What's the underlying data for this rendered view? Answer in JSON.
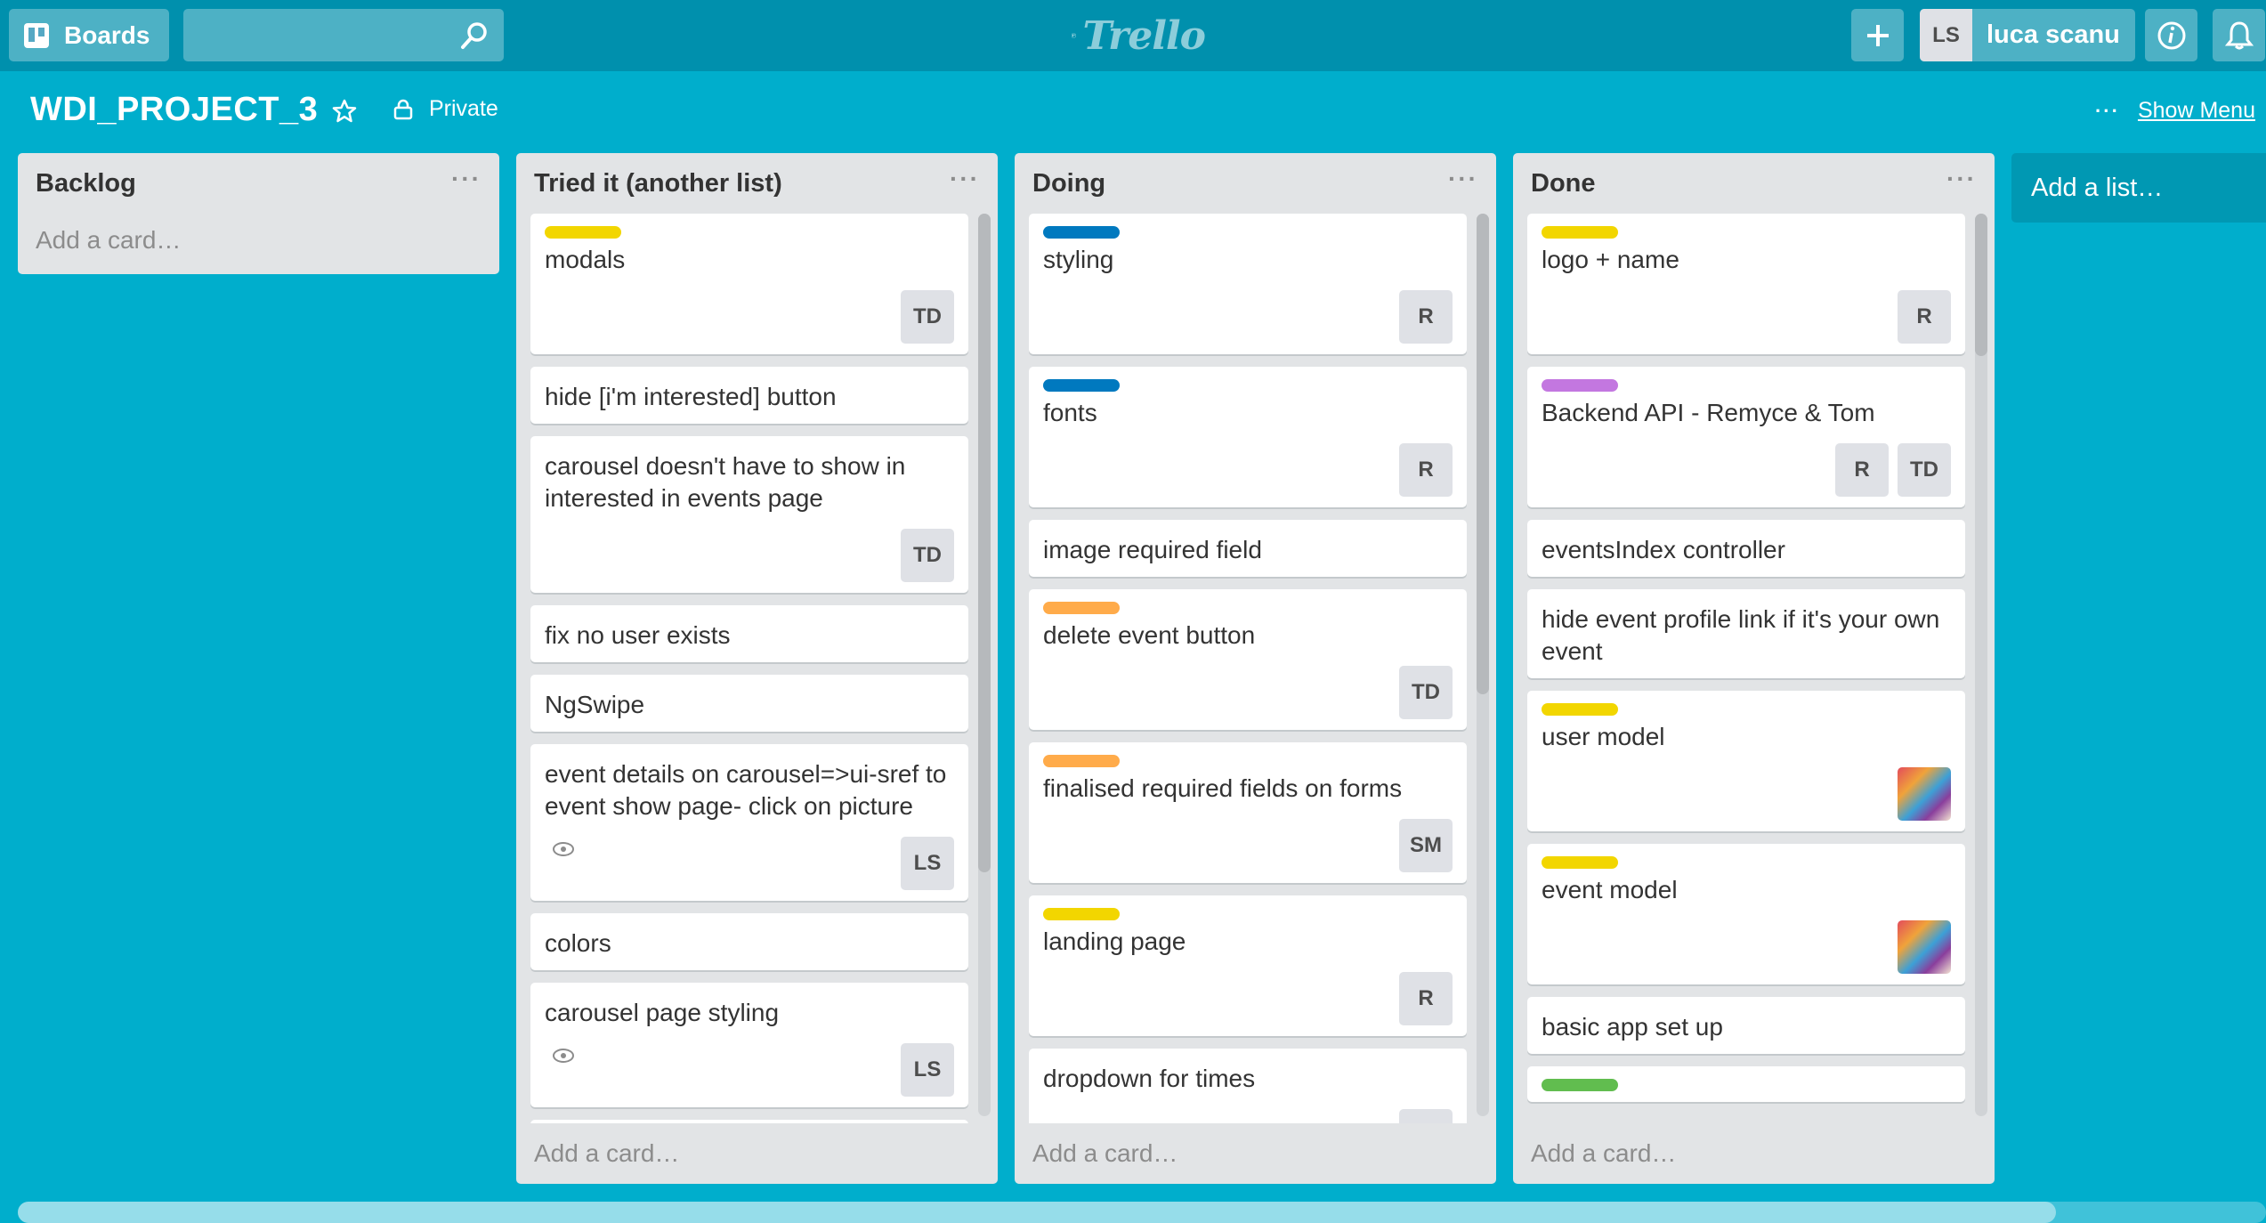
{
  "header": {
    "boards_label": "Boards",
    "logo_text": "Trello",
    "user_initials": "LS",
    "user_name": "luca scanu"
  },
  "board": {
    "title": "WDI_PROJECT_3",
    "visibility": "Private",
    "show_menu": "Show Menu",
    "add_list": "Add a list…",
    "list_menu_glyph": "···"
  },
  "colors": {
    "yellow": "#f2d600",
    "blue": "#0079bf",
    "orange": "#ffab4a",
    "purple": "#c377e0",
    "green": "#61bd4f"
  },
  "lists": [
    {
      "title": "Backlog",
      "add_card": "Add a card…",
      "cards": []
    },
    {
      "title": "Tried it (another list)",
      "add_card": "Add a card…",
      "cards": [
        {
          "label": "yellow",
          "text": "modals",
          "members": [
            "TD"
          ]
        },
        {
          "text": "hide [i'm interested] button"
        },
        {
          "text": "carousel doesn't have to show in interested in events page",
          "members": [
            "TD"
          ]
        },
        {
          "text": "fix no user exists"
        },
        {
          "text": "NgSwipe"
        },
        {
          "text": "event details on carousel=>ui-sref to event show page- click on picture",
          "watch": true,
          "members": [
            "LS"
          ]
        },
        {
          "text": "colors"
        },
        {
          "text": "carousel page styling",
          "watch": true,
          "members": [
            "LS"
          ]
        },
        {
          "label": "orange",
          "text": ""
        }
      ]
    },
    {
      "title": "Doing",
      "add_card": "Add a card…",
      "cards": [
        {
          "label": "blue",
          "text": "styling",
          "members": [
            "R"
          ]
        },
        {
          "label": "blue",
          "text": "fonts",
          "members": [
            "R"
          ]
        },
        {
          "text": "image required field"
        },
        {
          "label": "orange",
          "text": "delete event button",
          "members": [
            "TD"
          ]
        },
        {
          "label": "orange",
          "text": "finalised required fields on forms",
          "members": [
            "SM"
          ]
        },
        {
          "label": "yellow",
          "text": "landing page",
          "members": [
            "R"
          ]
        },
        {
          "text": "dropdown for times",
          "members": [
            ""
          ]
        }
      ]
    },
    {
      "title": "Done",
      "add_card": "Add a card…",
      "cards": [
        {
          "label": "yellow",
          "text": "logo + name",
          "members": [
            "R"
          ]
        },
        {
          "label": "purple",
          "text": "Backend API - Remyce & Tom",
          "members": [
            "R",
            "TD"
          ]
        },
        {
          "text": "eventsIndex controller"
        },
        {
          "text": "hide event profile link if it's your own event"
        },
        {
          "label": "yellow",
          "text": "user model",
          "members": [
            "@img"
          ]
        },
        {
          "label": "yellow",
          "text": "event model",
          "members": [
            "@img"
          ]
        },
        {
          "text": "basic app set up"
        },
        {
          "label": "green",
          "text": ""
        }
      ]
    }
  ]
}
